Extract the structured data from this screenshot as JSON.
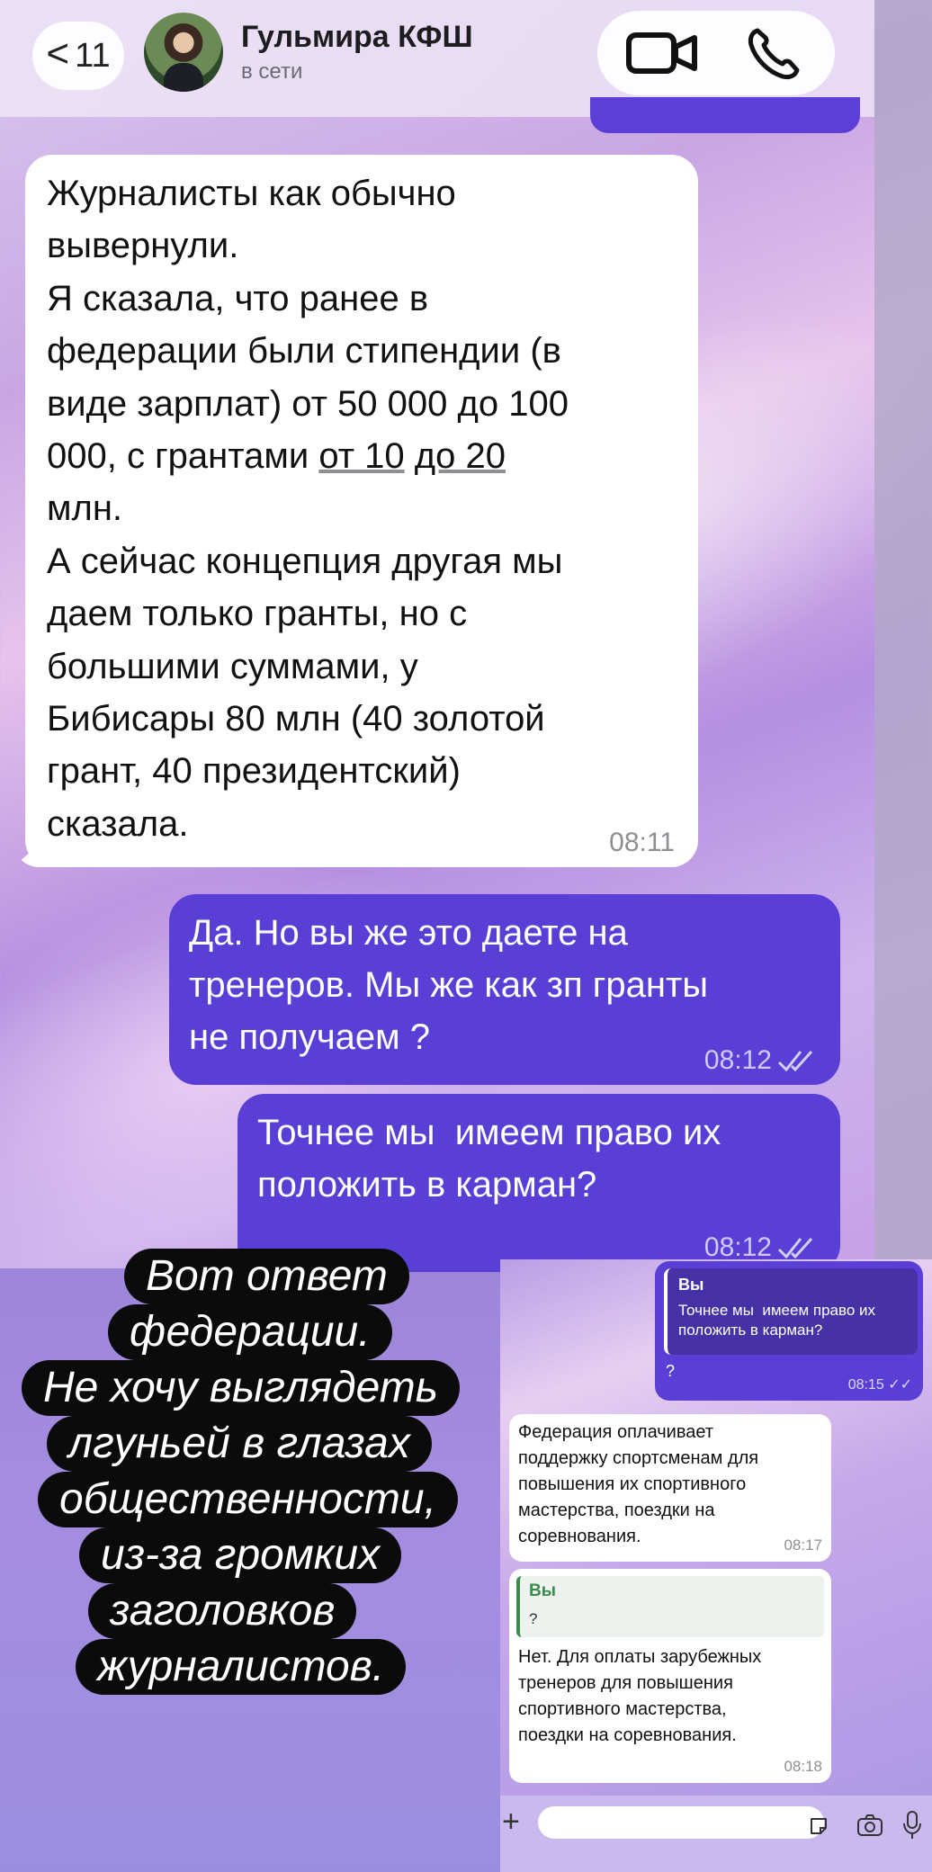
{
  "header": {
    "back_chevron": "<",
    "back_count": "11",
    "contact_name": "Гульмира КФШ",
    "contact_status": "в сети"
  },
  "messages": {
    "incoming": {
      "lines_a": "Журналисты как обычно\nвывернули.\nЯ сказала, что ранее в\nфедерации были стипендии (в\nвиде зарплат) от 50 000 до 100\n000, с грантами ",
      "underline_1": "от 10",
      "mid": " ",
      "underline_2": "до 20",
      "lines_b": "\nмлн.\nА сейчас концепция другая мы\nдаем только гранты, но с\nбольшими суммами, у\nБибисары 80 млн (40 золотой\nгрант, 40 президентский)\nсказала.",
      "time": "08:11"
    },
    "outgoing_1": {
      "text": "Да. Но вы же это даете на\nтренеров. Мы же как зп гранты\nне получаем ?",
      "time": "08:12"
    },
    "outgoing_2": {
      "text": "Точнее мы  имеем право их\nположить в карман?",
      "time": "08:12"
    }
  },
  "caption": {
    "lines": [
      "Вот ответ",
      "федерации.",
      "Не хочу выглядеть",
      "лгуньей в глазах",
      "общественности,",
      "из-за громких",
      "заголовков",
      "журналистов."
    ]
  },
  "inset": {
    "outgoing": {
      "quote_name": "Вы",
      "quote_text": "Точнее мы  имеем право их\nположить в карман?",
      "text": "?",
      "time": "08:15"
    },
    "incoming_1": {
      "text": "Федерация оплачивает\nподдержку спортсменам для\nповышения их спортивного\nмастерства, поездки на\nсоревнования.",
      "time": "08:17"
    },
    "incoming_2": {
      "quote_name": "Вы",
      "quote_text": "?",
      "text": "Нет. Для оплаты зарубежных\nтренеров для повышения\nспортивного мастерства,\nпоездки на соревнования.",
      "time": "08:18"
    },
    "composer_plus": "+"
  },
  "icons": {
    "back": "chevron-left-icon",
    "video": "video-camera-icon",
    "phone": "phone-icon",
    "read_receipt": "double-check-icon",
    "sticker": "sticker-icon",
    "camera": "camera-icon",
    "mic": "microphone-icon"
  },
  "colors": {
    "outgoing_bubble": "#5a3fd6",
    "incoming_bubble": "#ffffff",
    "caption_bg": "#0b0b0b",
    "quote_accent_green": "#3a8a4e"
  }
}
